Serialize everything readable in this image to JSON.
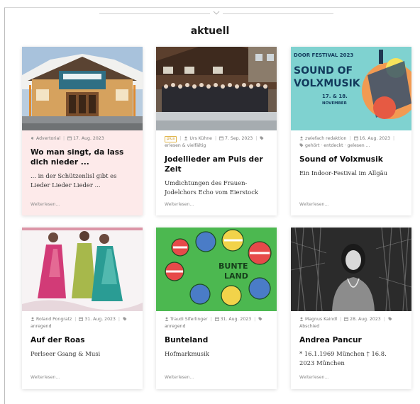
{
  "section": {
    "title": "aktuell"
  },
  "cards": [
    {
      "meta": {
        "category": "Advertorial",
        "date": "17. Aug. 2023"
      },
      "title": "Wo man singt, da lass dich nieder ...",
      "excerpt": "... in der Schützenlisl gibt es Lieder Lieder Lieder ...",
      "more": "Weiterlesen..."
    },
    {
      "meta": {
        "badge": "plus",
        "author": "Urs Kühne",
        "date": "7. Sep. 2023",
        "tag": "erlesen & vielfältig"
      },
      "title": "Jodellieder am Puls der Zeit",
      "excerpt": "Umdichtungen des Frauen-Jodelchors Echo vom Eierstock",
      "more": "Weiterlesen..."
    },
    {
      "meta": {
        "author": "zwiefach redaktion",
        "date": "16. Aug. 2023",
        "tags": "gehört · entdeckt · gelesen ..."
      },
      "title": "Sound of Volxmusik",
      "excerpt": "Ein Indoor-Festival im Allgäu",
      "more": "Weiterlesen...",
      "poster": {
        "line1": "DOOR FESTIVAL 2023",
        "line2": "SOUND OF",
        "line3": "VOLXMUSIK",
        "dates": "17. & 18.",
        "month": "NOVEMBER"
      }
    },
    {
      "meta": {
        "author": "Roland Pongratz",
        "date": "31. Aug. 2023",
        "tag": "anregend"
      },
      "title": "Auf der Roas",
      "excerpt": "Perlseer Gsang & Musi",
      "more": "Weiterlesen..."
    },
    {
      "meta": {
        "author": "Traudi Siferlinger",
        "date": "31. Aug. 2023",
        "tag": "anregend"
      },
      "title": "Bunteland",
      "excerpt": "Hofmarkmusik",
      "more": "Weiterlesen...",
      "art": {
        "word1": "BUNTE",
        "word2": "LAND"
      }
    },
    {
      "meta": {
        "author": "Magnus Kaindl",
        "date": "28. Aug. 2023",
        "tag": "Abschied"
      },
      "title": "Andrea Pancur",
      "excerpt": "* 16.1.1969 München † 16.8. 2023 München",
      "more": "Weiterlesen..."
    }
  ],
  "colors": {
    "pinkCard": "#fdeaea",
    "badge": "#e0b64a",
    "posterBg": "#7fd2d0",
    "posterText": "#123a5c"
  }
}
